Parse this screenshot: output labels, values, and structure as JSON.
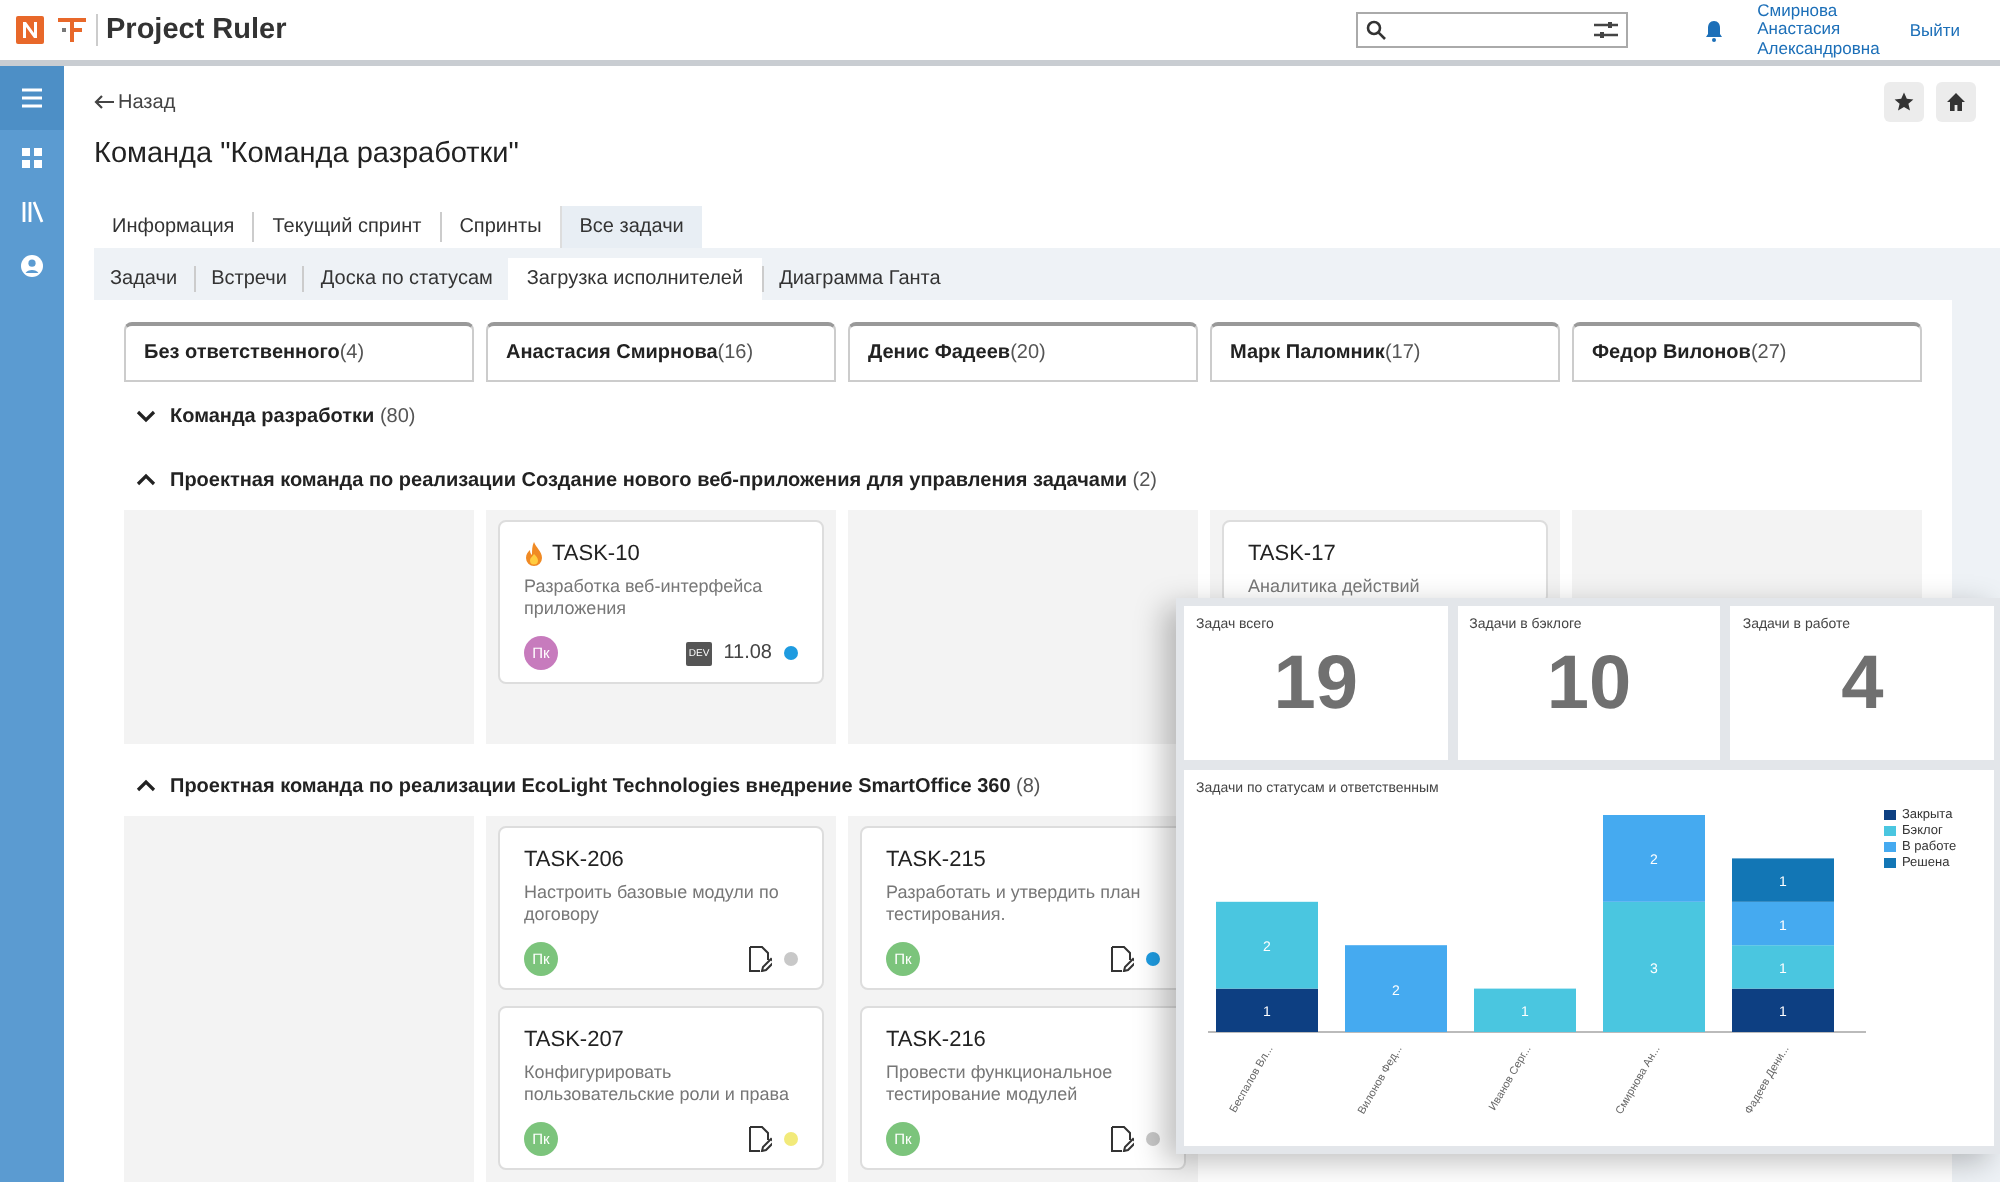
{
  "header": {
    "app_name": "Project Ruler",
    "user_name": [
      "Смирнова",
      "Анастасия",
      "Александровна"
    ],
    "logout": "Выйти"
  },
  "page": {
    "back": "Назад",
    "title": "Команда \"Команда разработки\""
  },
  "tabs": [
    {
      "label": "Информация",
      "selected": false
    },
    {
      "label": "Текущий спринт",
      "selected": false
    },
    {
      "label": "Спринты",
      "selected": false
    },
    {
      "label": "Все задачи",
      "selected": true
    }
  ],
  "subtabs": [
    {
      "label": "Задачи",
      "selected": false
    },
    {
      "label": "Встречи",
      "selected": false
    },
    {
      "label": "Доска по статусам",
      "selected": false
    },
    {
      "label": "Загрузка исполнителей",
      "selected": true
    },
    {
      "label": "Диаграмма Ганта",
      "selected": false
    }
  ],
  "assignees": [
    {
      "name": "Без ответственного",
      "count": "(4)"
    },
    {
      "name": "Анастасия Смирнова",
      "count": "(16)"
    },
    {
      "name": "Денис Фадеев",
      "count": "(20)"
    },
    {
      "name": "Марк Паломник",
      "count": "(17)"
    },
    {
      "name": "Федор Вилонов",
      "count": "(27)"
    }
  ],
  "groups": [
    {
      "title": "Команда разработки",
      "count": "(80)",
      "expanded": false
    },
    {
      "title": "Проектная команда по реализации Создание нового веб-приложения для управления задачами",
      "count": "(2)",
      "expanded": true,
      "columns": [
        [],
        [
          {
            "id": "TASK-10",
            "hot": true,
            "description": "Разработка веб-интерфейса приложения",
            "avatar": {
              "initials": "Пк",
              "color": "#c77bbd"
            },
            "tag": "DEV",
            "date": "11.08",
            "document": false,
            "status": {
              "color": "#1e9be0"
            }
          }
        ],
        [],
        [
          {
            "id": "TASK-17",
            "hot": false,
            "description": "Аналитика действий"
          }
        ],
        []
      ]
    },
    {
      "title": "Проектная команда по реализации EcoLight Technologies внедрение SmartOffice 360",
      "count": "(8)",
      "expanded": true,
      "columns": [
        [],
        [
          {
            "id": "TASK-206",
            "hot": false,
            "description": "Настроить базовые модули по договору",
            "avatar": {
              "initials": "Пк",
              "color": "#7cc47c"
            },
            "document": true,
            "status": {
              "color": "#c8c8c8"
            }
          },
          {
            "id": "TASK-207",
            "hot": false,
            "description": "Конфигурировать пользовательские роли и права",
            "avatar": {
              "initials": "Пк",
              "color": "#7cc47c"
            },
            "document": true,
            "status": {
              "color": "#f2ea7a"
            }
          }
        ],
        [
          {
            "id": "TASK-215",
            "hot": false,
            "description": "Разработать и утвердить план тестирования.",
            "avatar": {
              "initials": "Пк",
              "color": "#7cc47c"
            },
            "document": true,
            "status": {
              "color": "#1e9be0"
            }
          },
          {
            "id": "TASK-216",
            "hot": false,
            "description": "Провести функциональное тестирование модулей",
            "avatar": {
              "initials": "Пк",
              "color": "#7cc47c"
            },
            "document": true,
            "status": {
              "color": "#c8c8c8"
            }
          }
        ]
      ]
    }
  ],
  "dashboard": {
    "stats": [
      {
        "label": "Задач всего",
        "value": "19"
      },
      {
        "label": "Задачи в бэклоге",
        "value": "10"
      },
      {
        "label": "Задачи в работе",
        "value": "4"
      }
    ],
    "chart_data": {
      "type": "bar",
      "title": "Задачи по статусам и ответственным",
      "categories": [
        "Беспалов Вл...",
        "Вилонов Фед...",
        "Иванов Серг...",
        "Смирнова Ан...",
        "Фадеев Дени..."
      ],
      "stacked": true,
      "data_labels": true,
      "legend": true,
      "series": [
        {
          "name": "Закрыта",
          "color": "#0d3f82",
          "values": [
            1,
            null,
            null,
            null,
            1
          ]
        },
        {
          "name": "Бэклог",
          "color": "#4ac6e0",
          "values": [
            2,
            null,
            1,
            3,
            1
          ]
        },
        {
          "name": "В работе",
          "color": "#45aaf0",
          "values": [
            null,
            2,
            null,
            2,
            1
          ]
        },
        {
          "name": "Решена",
          "color": "#1276b5",
          "values": [
            null,
            null,
            null,
            null,
            1
          ]
        }
      ]
    }
  }
}
